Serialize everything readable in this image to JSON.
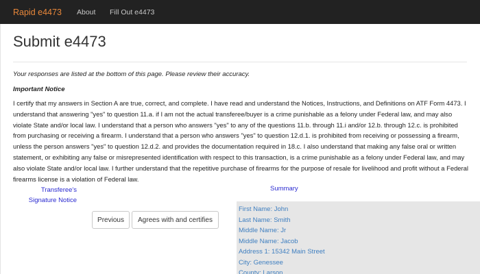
{
  "navbar": {
    "brand": "Rapid e4473",
    "links": [
      {
        "label": "About"
      },
      {
        "label": "Fill Out e4473"
      }
    ]
  },
  "page": {
    "title": "Submit e4473",
    "review_note": "Your responses are listed at the bottom of this page. Please review their accuracy.",
    "notice_heading": "Important Notice",
    "certification_text": "I certify that my answers in Section A are true, correct, and complete. I have read and understand the Notices, Instructions, and Definitions on ATF Form 4473. I understand that answering \"yes\" to question 11.a. if I am not the actual transferee/buyer is a crime punishable as a felony under Federal law, and may also violate State and/or local law. I understand that a person who answers \"yes\" to any of the questions 11.b. through 11.i and/or 12.b. through 12.c. is prohibited from purchasing or receiving a firearm. I understand that a person who answers \"yes\" to question 12.d.1. is prohibited from receiving or possessing a firearm, unless the person answers \"yes\" to question 12.d.2. and provides the documentation required in 18.c. I also understand that making any false oral or written statement, or exhibiting any false or misrepresented identification with respect to this transaction, is a crime punishable as a felony under Federal law, and may also violate State and/or local law. I further understand that the repetitive purchase of firearms for the purpose of resale for livelihood and profit without a Federal firearms license is a violation of Federal law.",
    "signature_notice": "Transferee's Signature Notice",
    "summary_label": "Summary"
  },
  "buttons": {
    "previous": "Previous",
    "agree": "Agrees with and certifies"
  },
  "summary": {
    "rows": [
      "First Name: John",
      "Last Name: Smith",
      "Middle Name: Jr",
      "Middle Name: Jacob",
      "Address 1: 15342 Main Street",
      "City: Genessee",
      "County: Larson"
    ]
  },
  "colors": {
    "navbar_bg": "#222222",
    "brand": "#e8873a",
    "link_blue": "#2a2ad0",
    "summary_text": "#3f7fc0",
    "summary_bg": "#e6e6e6"
  }
}
